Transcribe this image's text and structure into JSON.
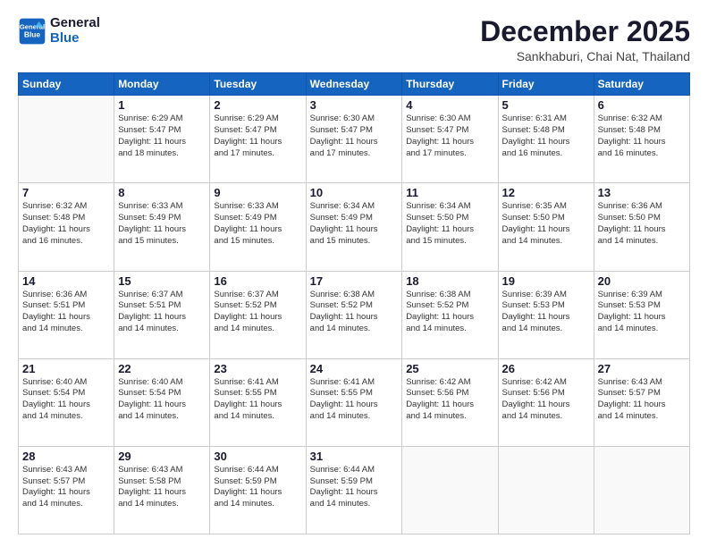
{
  "logo": {
    "line1": "General",
    "line2": "Blue"
  },
  "title": "December 2025",
  "subtitle": "Sankhaburi, Chai Nat, Thailand",
  "header_days": [
    "Sunday",
    "Monday",
    "Tuesday",
    "Wednesday",
    "Thursday",
    "Friday",
    "Saturday"
  ],
  "weeks": [
    [
      {
        "num": "",
        "info": ""
      },
      {
        "num": "1",
        "info": "Sunrise: 6:29 AM\nSunset: 5:47 PM\nDaylight: 11 hours\nand 18 minutes."
      },
      {
        "num": "2",
        "info": "Sunrise: 6:29 AM\nSunset: 5:47 PM\nDaylight: 11 hours\nand 17 minutes."
      },
      {
        "num": "3",
        "info": "Sunrise: 6:30 AM\nSunset: 5:47 PM\nDaylight: 11 hours\nand 17 minutes."
      },
      {
        "num": "4",
        "info": "Sunrise: 6:30 AM\nSunset: 5:47 PM\nDaylight: 11 hours\nand 17 minutes."
      },
      {
        "num": "5",
        "info": "Sunrise: 6:31 AM\nSunset: 5:48 PM\nDaylight: 11 hours\nand 16 minutes."
      },
      {
        "num": "6",
        "info": "Sunrise: 6:32 AM\nSunset: 5:48 PM\nDaylight: 11 hours\nand 16 minutes."
      }
    ],
    [
      {
        "num": "7",
        "info": "Sunrise: 6:32 AM\nSunset: 5:48 PM\nDaylight: 11 hours\nand 16 minutes."
      },
      {
        "num": "8",
        "info": "Sunrise: 6:33 AM\nSunset: 5:49 PM\nDaylight: 11 hours\nand 15 minutes."
      },
      {
        "num": "9",
        "info": "Sunrise: 6:33 AM\nSunset: 5:49 PM\nDaylight: 11 hours\nand 15 minutes."
      },
      {
        "num": "10",
        "info": "Sunrise: 6:34 AM\nSunset: 5:49 PM\nDaylight: 11 hours\nand 15 minutes."
      },
      {
        "num": "11",
        "info": "Sunrise: 6:34 AM\nSunset: 5:50 PM\nDaylight: 11 hours\nand 15 minutes."
      },
      {
        "num": "12",
        "info": "Sunrise: 6:35 AM\nSunset: 5:50 PM\nDaylight: 11 hours\nand 14 minutes."
      },
      {
        "num": "13",
        "info": "Sunrise: 6:36 AM\nSunset: 5:50 PM\nDaylight: 11 hours\nand 14 minutes."
      }
    ],
    [
      {
        "num": "14",
        "info": "Sunrise: 6:36 AM\nSunset: 5:51 PM\nDaylight: 11 hours\nand 14 minutes."
      },
      {
        "num": "15",
        "info": "Sunrise: 6:37 AM\nSunset: 5:51 PM\nDaylight: 11 hours\nand 14 minutes."
      },
      {
        "num": "16",
        "info": "Sunrise: 6:37 AM\nSunset: 5:52 PM\nDaylight: 11 hours\nand 14 minutes."
      },
      {
        "num": "17",
        "info": "Sunrise: 6:38 AM\nSunset: 5:52 PM\nDaylight: 11 hours\nand 14 minutes."
      },
      {
        "num": "18",
        "info": "Sunrise: 6:38 AM\nSunset: 5:52 PM\nDaylight: 11 hours\nand 14 minutes."
      },
      {
        "num": "19",
        "info": "Sunrise: 6:39 AM\nSunset: 5:53 PM\nDaylight: 11 hours\nand 14 minutes."
      },
      {
        "num": "20",
        "info": "Sunrise: 6:39 AM\nSunset: 5:53 PM\nDaylight: 11 hours\nand 14 minutes."
      }
    ],
    [
      {
        "num": "21",
        "info": "Sunrise: 6:40 AM\nSunset: 5:54 PM\nDaylight: 11 hours\nand 14 minutes."
      },
      {
        "num": "22",
        "info": "Sunrise: 6:40 AM\nSunset: 5:54 PM\nDaylight: 11 hours\nand 14 minutes."
      },
      {
        "num": "23",
        "info": "Sunrise: 6:41 AM\nSunset: 5:55 PM\nDaylight: 11 hours\nand 14 minutes."
      },
      {
        "num": "24",
        "info": "Sunrise: 6:41 AM\nSunset: 5:55 PM\nDaylight: 11 hours\nand 14 minutes."
      },
      {
        "num": "25",
        "info": "Sunrise: 6:42 AM\nSunset: 5:56 PM\nDaylight: 11 hours\nand 14 minutes."
      },
      {
        "num": "26",
        "info": "Sunrise: 6:42 AM\nSunset: 5:56 PM\nDaylight: 11 hours\nand 14 minutes."
      },
      {
        "num": "27",
        "info": "Sunrise: 6:43 AM\nSunset: 5:57 PM\nDaylight: 11 hours\nand 14 minutes."
      }
    ],
    [
      {
        "num": "28",
        "info": "Sunrise: 6:43 AM\nSunset: 5:57 PM\nDaylight: 11 hours\nand 14 minutes."
      },
      {
        "num": "29",
        "info": "Sunrise: 6:43 AM\nSunset: 5:58 PM\nDaylight: 11 hours\nand 14 minutes."
      },
      {
        "num": "30",
        "info": "Sunrise: 6:44 AM\nSunset: 5:59 PM\nDaylight: 11 hours\nand 14 minutes."
      },
      {
        "num": "31",
        "info": "Sunrise: 6:44 AM\nSunset: 5:59 PM\nDaylight: 11 hours\nand 14 minutes."
      },
      {
        "num": "",
        "info": ""
      },
      {
        "num": "",
        "info": ""
      },
      {
        "num": "",
        "info": ""
      }
    ]
  ]
}
